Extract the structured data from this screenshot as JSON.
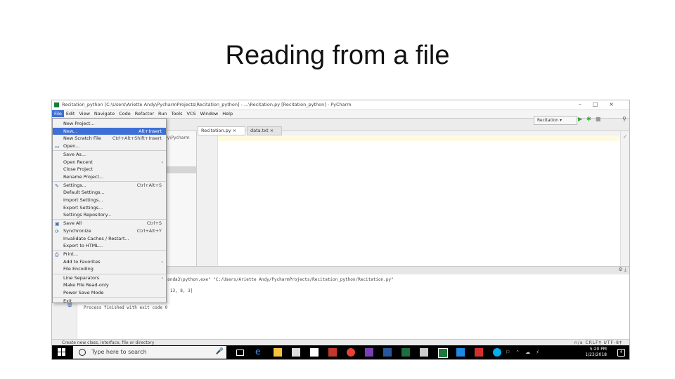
{
  "slide": {
    "title": "Reading from a file"
  },
  "window": {
    "title": "Recitation_python [C:\\Users\\Ariette Andy\\PycharmProjects\\Recitation_python] - ...\\Recitation.py [Recitation_python] - PyCharm",
    "controls": [
      "–",
      "□",
      "×"
    ]
  },
  "menubar": [
    "File",
    "Edit",
    "View",
    "Navigate",
    "Code",
    "Refactor",
    "Run",
    "Tools",
    "VCS",
    "Window",
    "Help"
  ],
  "tabs": [
    {
      "label": "Recitation.py ×"
    },
    {
      "label": "data.txt ×"
    }
  ],
  "run_config": "Recitation ▾",
  "project_path": "dy\\Pycharm",
  "file_menu": [
    {
      "label": "New Project...",
      "shortcut": "",
      "arrow": false,
      "icon": "",
      "selected": false
    },
    {
      "label": "New...",
      "shortcut": "Alt+Insert",
      "arrow": false,
      "icon": "",
      "selected": true
    },
    {
      "label": "New Scratch File",
      "shortcut": "Ctrl+Alt+Shift+Insert",
      "arrow": false,
      "icon": "",
      "selected": false
    },
    {
      "label": "Open...",
      "shortcut": "",
      "arrow": false,
      "icon": "folder-icon",
      "selected": false
    },
    {
      "label": "Save As...",
      "shortcut": "",
      "arrow": false,
      "icon": "",
      "selected": false
    },
    {
      "label": "Open Recent",
      "shortcut": "",
      "arrow": true,
      "icon": "",
      "selected": false
    },
    {
      "label": "Close Project",
      "shortcut": "",
      "arrow": false,
      "icon": "",
      "selected": false
    },
    {
      "label": "Rename Project...",
      "shortcut": "",
      "arrow": false,
      "icon": "",
      "selected": false
    },
    {
      "label": "Settings...",
      "shortcut": "Ctrl+Alt+S",
      "arrow": false,
      "icon": "wrench-icon",
      "selected": false
    },
    {
      "label": "Default Settings...",
      "shortcut": "",
      "arrow": false,
      "icon": "",
      "selected": false
    },
    {
      "label": "Import Settings...",
      "shortcut": "",
      "arrow": false,
      "icon": "",
      "selected": false
    },
    {
      "label": "Export Settings...",
      "shortcut": "",
      "arrow": false,
      "icon": "",
      "selected": false
    },
    {
      "label": "Settings Repository...",
      "shortcut": "",
      "arrow": false,
      "icon": "",
      "selected": false
    },
    {
      "label": "Save All",
      "shortcut": "Ctrl+S",
      "arrow": false,
      "icon": "save-icon",
      "selected": false
    },
    {
      "label": "Synchronize",
      "shortcut": "Ctrl+Alt+Y",
      "arrow": false,
      "icon": "sync-icon",
      "selected": false
    },
    {
      "label": "Invalidate Caches / Restart...",
      "shortcut": "",
      "arrow": false,
      "icon": "",
      "selected": false
    },
    {
      "label": "Export to HTML...",
      "shortcut": "",
      "arrow": false,
      "icon": "",
      "selected": false
    },
    {
      "label": "Print...",
      "shortcut": "",
      "arrow": false,
      "icon": "print-icon",
      "selected": false
    },
    {
      "label": "Add to Favorites",
      "shortcut": "",
      "arrow": true,
      "icon": "",
      "selected": false
    },
    {
      "label": "File Encoding",
      "shortcut": "",
      "arrow": false,
      "icon": "",
      "selected": false
    },
    {
      "label": "Line Separators",
      "shortcut": "",
      "arrow": true,
      "icon": "",
      "selected": false
    },
    {
      "label": "Make File Read-only",
      "shortcut": "",
      "arrow": false,
      "icon": "",
      "selected": false
    },
    {
      "label": "Power Save Mode",
      "shortcut": "",
      "arrow": false,
      "icon": "",
      "selected": false
    },
    {
      "label": "Exit",
      "shortcut": "",
      "arrow": false,
      "icon": "",
      "selected": false
    }
  ],
  "console": {
    "command": "aconda3\\python.exe\" \"C:/Users/Ariette Andy/PycharmProjects/Recitation_python/Recitation.py\"",
    "output": "5, 13, 8, 3]",
    "exit": "Process finished with exit code 0"
  },
  "status": {
    "message": "Create new class, interface, file or directory",
    "right": "n/a   CRLF‡   UTF-8‡"
  },
  "taskbar": {
    "search_placeholder": "Type here to search",
    "time": "5:20 PM",
    "date": "1/23/2018",
    "notifications": "4"
  },
  "colors": {
    "selection": "#3d6fd6",
    "taskbar": "#000000",
    "pycharm_green": "#1d7a3a"
  }
}
